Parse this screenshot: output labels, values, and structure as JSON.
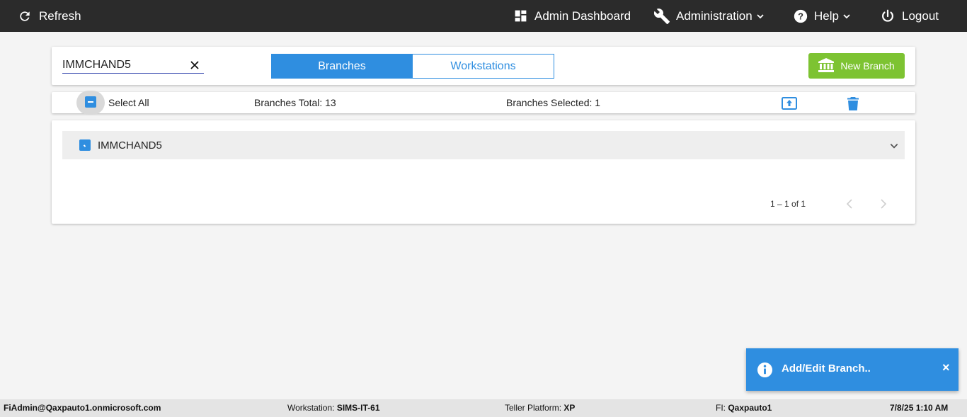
{
  "topbar": {
    "refresh": "Refresh",
    "admin_dashboard": "Admin Dashboard",
    "administration": "Administration",
    "help": "Help",
    "logout": "Logout"
  },
  "search": {
    "value": "IMMCHAND5"
  },
  "tabs": [
    {
      "label": "Branches",
      "active": true
    },
    {
      "label": "Workstations",
      "active": false
    }
  ],
  "new_branch": {
    "label": "New Branch"
  },
  "selection_bar": {
    "select_all": "Select All",
    "branches_total": "Branches Total: 13",
    "branches_selected": "Branches Selected: 1"
  },
  "list": {
    "rows": [
      {
        "label": "IMMCHAND5",
        "checked": true
      }
    ],
    "pager": "1 – 1 of 1"
  },
  "toast": {
    "message": "Add/Edit Branch..",
    "close": "×"
  },
  "footer": {
    "user": "FiAdmin@Qaxpauto1.onmicrosoft.com",
    "workstation_label": "Workstation: ",
    "workstation_value": "SIMS-IT-61",
    "teller_platform_label": "Teller Platform: ",
    "teller_platform_value": "XP",
    "fi_label": "FI: ",
    "fi_value": "Qaxpauto1",
    "datetime": "7/8/25 1:10 AM"
  },
  "colors": {
    "topbar": "#2b2b2b",
    "accent": "#2f8ee0",
    "new_branch": "#7dc332",
    "footer": "#e4e4e4"
  }
}
